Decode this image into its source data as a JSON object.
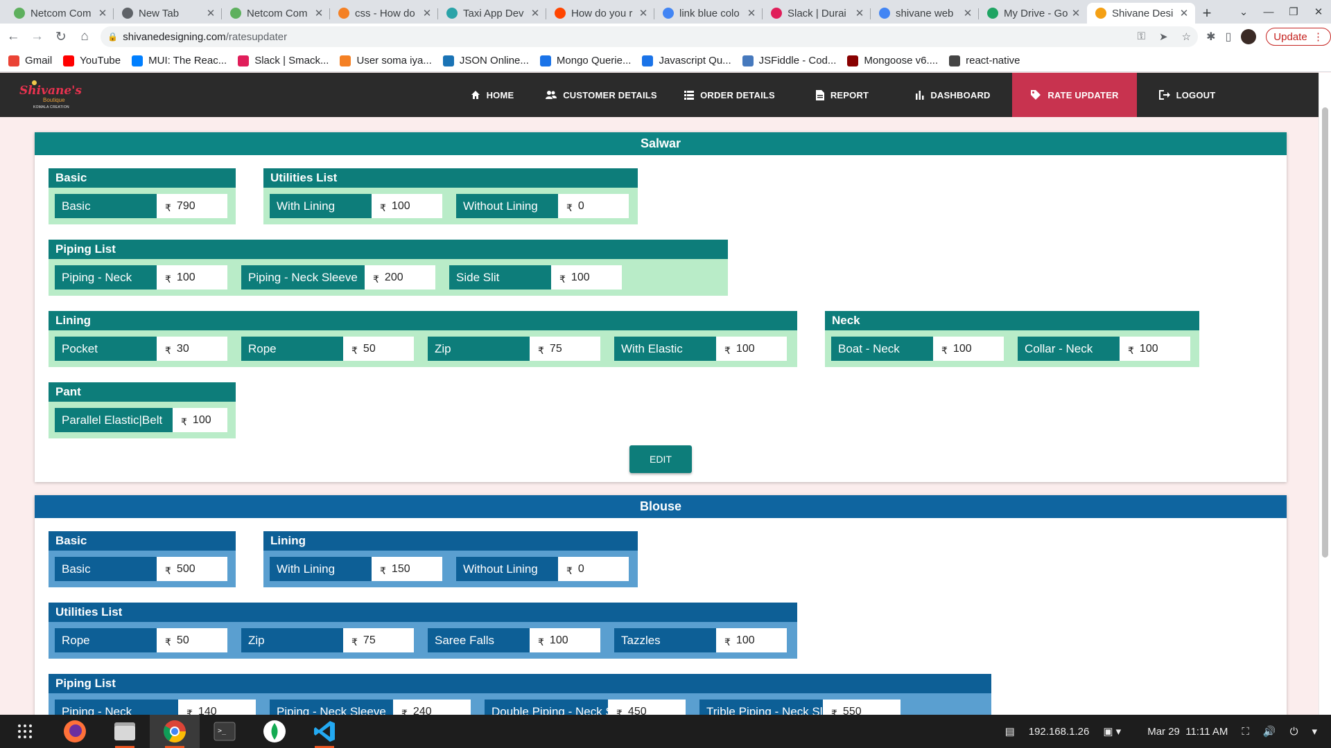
{
  "browser": {
    "tabs": [
      {
        "title": "Netcom Com",
        "color": "#5eb05e"
      },
      {
        "title": "New Tab",
        "color": "#5f6368"
      },
      {
        "title": "Netcom Com",
        "color": "#5eb05e"
      },
      {
        "title": "css - How do",
        "color": "#f48024"
      },
      {
        "title": "Taxi App Dev",
        "color": "#2aa3a8"
      },
      {
        "title": "How do you r",
        "color": "#ff4500"
      },
      {
        "title": "link blue colo",
        "color": "#4285f4"
      },
      {
        "title": "Slack | Durai",
        "color": "#e01e5a"
      },
      {
        "title": "shivane web",
        "color": "#4285f4"
      },
      {
        "title": "My Drive - Go",
        "color": "#1fa463"
      },
      {
        "title": "Shivane Desi",
        "color": "#f4a014",
        "active": true
      }
    ],
    "address": {
      "host": "shivanedesigning.com",
      "path": "/ratesupdater"
    },
    "update_label": "Update",
    "bookmarks": [
      {
        "label": "Gmail",
        "color": "#ea4335"
      },
      {
        "label": "YouTube",
        "color": "#ff0000"
      },
      {
        "label": "MUI: The Reac...",
        "color": "#007fff"
      },
      {
        "label": "Slack | Smack...",
        "color": "#e01e5a"
      },
      {
        "label": "User soma iya...",
        "color": "#f48024"
      },
      {
        "label": "JSON Online...",
        "color": "#1a73b5"
      },
      {
        "label": "Mongo Querie...",
        "color": "#1a73e8"
      },
      {
        "label": "Javascript Qu...",
        "color": "#1a73e8"
      },
      {
        "label": "JSFiddle - Cod...",
        "color": "#4679bd"
      },
      {
        "label": "Mongoose v6....",
        "color": "#880000"
      },
      {
        "label": "react-native",
        "color": "#444444"
      }
    ]
  },
  "app": {
    "logo": {
      "name": "Shivane's",
      "sub": "Boutique",
      "tag": "KOMALA CREATION"
    },
    "menu": [
      {
        "label": "HOME",
        "icon": "home-icon",
        "width": 120
      },
      {
        "label": "CUSTOMER DETAILS",
        "icon": "users-icon",
        "width": 195
      },
      {
        "label": "ORDER DETAILS",
        "icon": "list-icon",
        "width": 175
      },
      {
        "label": "REPORT",
        "icon": "report-icon",
        "width": 150
      },
      {
        "label": "DASHBOARD",
        "icon": "chart-bar-icon",
        "width": 170
      },
      {
        "label": "RATE UPDATER",
        "icon": "tag-icon",
        "width": 180,
        "active": true
      },
      {
        "label": "LOGOUT",
        "icon": "logout-icon",
        "width": 145
      }
    ]
  },
  "currency_symbol": "₹",
  "salwar": {
    "title": "Salwar",
    "edit_label": "EDIT",
    "groups": {
      "basic": {
        "title": "Basic",
        "items": [
          {
            "label": "Basic",
            "value": "790"
          }
        ]
      },
      "utilities": {
        "title": "Utilities List",
        "items": [
          {
            "label": "With Lining",
            "value": "100"
          },
          {
            "label": "Without Lining",
            "value": "0"
          }
        ]
      },
      "piping": {
        "title": "Piping List",
        "items": [
          {
            "label": "Piping - Neck",
            "value": "100"
          },
          {
            "label": "Piping - Neck Sleeve",
            "value": "200"
          },
          {
            "label": "Side Slit",
            "value": "100"
          }
        ]
      },
      "lining": {
        "title": "Lining",
        "items": [
          {
            "label": "Pocket",
            "value": "30"
          },
          {
            "label": "Rope",
            "value": "50"
          },
          {
            "label": "Zip",
            "value": "75"
          },
          {
            "label": "With Elastic",
            "value": "100"
          }
        ]
      },
      "neck": {
        "title": "Neck",
        "items": [
          {
            "label": "Boat - Neck",
            "value": "100"
          },
          {
            "label": "Collar - Neck",
            "value": "100"
          }
        ]
      },
      "pant": {
        "title": "Pant",
        "items": [
          {
            "label": "Parallel Elastic|Belt",
            "value": "100"
          }
        ]
      }
    }
  },
  "blouse": {
    "title": "Blouse",
    "groups": {
      "basic": {
        "title": "Basic",
        "items": [
          {
            "label": "Basic",
            "value": "500"
          }
        ]
      },
      "lining": {
        "title": "Lining",
        "items": [
          {
            "label": "With Lining",
            "value": "150"
          },
          {
            "label": "Without Lining",
            "value": "0"
          }
        ]
      },
      "utilities": {
        "title": "Utilities List",
        "items": [
          {
            "label": "Rope",
            "value": "50"
          },
          {
            "label": "Zip",
            "value": "75"
          },
          {
            "label": "Saree Falls",
            "value": "100"
          },
          {
            "label": "Tazzles",
            "value": "100"
          }
        ]
      },
      "piping": {
        "title": "Piping List",
        "items": [
          {
            "label": "Piping - Neck",
            "value": "140"
          },
          {
            "label": "Piping - Neck Sleeve",
            "value": "240"
          },
          {
            "label": "Double Piping - Neck Sleeve",
            "value": "450"
          },
          {
            "label": "Trible Piping - Neck Sleeve",
            "value": "550"
          }
        ]
      }
    }
  },
  "taskbar": {
    "ip": "192.168.1.26",
    "datetime": "Mar 29  11:11 AM",
    "apps": [
      "grid-icon",
      "firefox-icon",
      "files-icon",
      "chrome-icon",
      "terminal-icon",
      "mongodb-compass-icon",
      "vscode-icon"
    ]
  }
}
